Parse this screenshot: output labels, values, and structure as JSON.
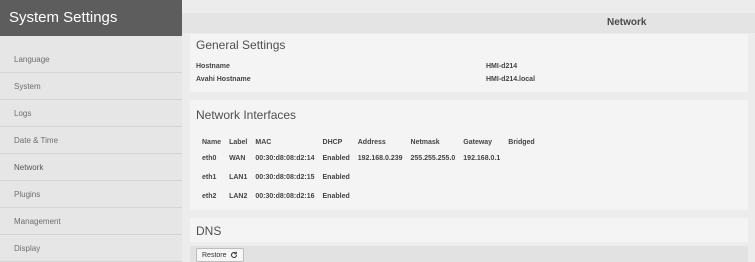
{
  "sidebar": {
    "title": "System Settings",
    "items": [
      {
        "label": "Language"
      },
      {
        "label": "System"
      },
      {
        "label": "Logs"
      },
      {
        "label": "Date & Time"
      },
      {
        "label": "Network"
      },
      {
        "label": "Plugins"
      },
      {
        "label": "Management"
      },
      {
        "label": "Display"
      }
    ]
  },
  "header": {
    "title": "Network"
  },
  "general": {
    "heading": "General Settings",
    "hostname_label": "Hostname",
    "hostname_value": "HMI-d214",
    "avahi_label": "Avahi Hostname",
    "avahi_value": "HMI-d214.local"
  },
  "interfaces": {
    "heading": "Network Interfaces",
    "columns": [
      "Name",
      "Label",
      "MAC",
      "DHCP",
      "Address",
      "Netmask",
      "Gateway",
      "Bridged"
    ],
    "rows": [
      [
        "eth0",
        "WAN",
        "00:30:d8:08:d2:14",
        "Enabled",
        "192.168.0.239",
        "255.255.255.0",
        "192.168.0.1",
        ""
      ],
      [
        "eth1",
        "LAN1",
        "00:30:d8:08:d2:15",
        "Enabled",
        "",
        "",
        "",
        ""
      ],
      [
        "eth2",
        "LAN2",
        "00:30:d8:08:d2:16",
        "Enabled",
        "",
        "",
        "",
        ""
      ]
    ]
  },
  "dns": {
    "heading": "DNS"
  },
  "footer": {
    "restore_label": "Restore",
    "restore_icon": "refresh-icon"
  }
}
